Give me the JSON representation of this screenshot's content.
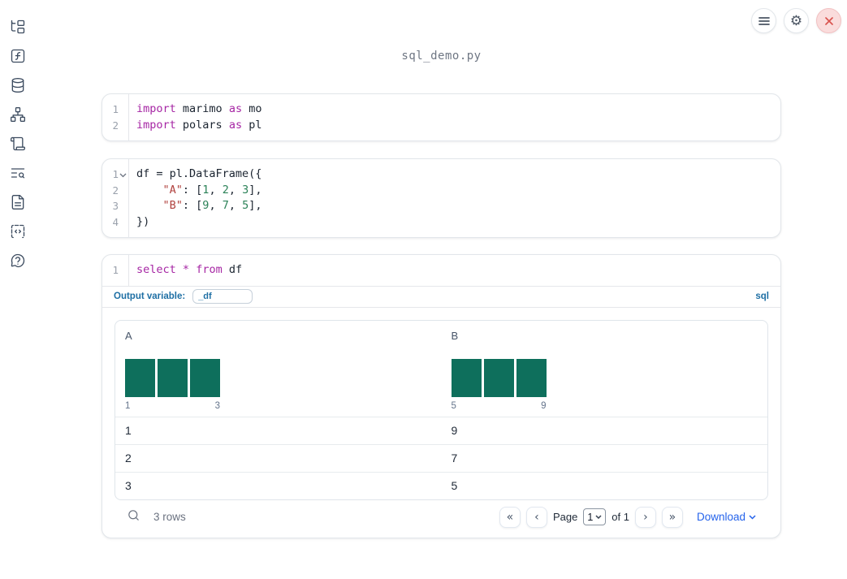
{
  "window": {
    "title": "sql_demo.py"
  },
  "header": {
    "buttons": [
      {
        "icon": "menu-icon"
      },
      {
        "icon": "gear-icon"
      },
      {
        "icon": "close-icon"
      }
    ]
  },
  "sidebar": {
    "items": [
      {
        "icon": "file-tree-icon"
      },
      {
        "icon": "function-square-icon"
      },
      {
        "icon": "database-icon"
      },
      {
        "icon": "dependency-graph-icon"
      },
      {
        "icon": "scroll-icon"
      },
      {
        "icon": "text-search-icon"
      },
      {
        "icon": "document-icon"
      },
      {
        "icon": "code-snippets-icon"
      },
      {
        "icon": "help-bubble-icon"
      }
    ]
  },
  "cells": [
    {
      "id": "imports-cell",
      "lines": [
        {
          "n": "1",
          "seg": [
            [
              "kw",
              "import"
            ],
            [
              "pl",
              " marimo "
            ],
            [
              "kw",
              "as"
            ],
            [
              "pl",
              " mo"
            ]
          ]
        },
        {
          "n": "2",
          "seg": [
            [
              "kw",
              "import"
            ],
            [
              "pl",
              " polars "
            ],
            [
              "kw",
              "as"
            ],
            [
              "pl",
              " pl"
            ]
          ]
        }
      ]
    },
    {
      "id": "dataframe-cell",
      "lines": [
        {
          "n": "1",
          "fold": true,
          "seg": [
            [
              "pl",
              "df = pl.DataFrame({"
            ]
          ]
        },
        {
          "n": "2",
          "seg": [
            [
              "pl",
              "    "
            ],
            [
              "str",
              "\"A\""
            ],
            [
              "pl",
              ": ["
            ],
            [
              "num",
              "1"
            ],
            [
              "pl",
              ", "
            ],
            [
              "num",
              "2"
            ],
            [
              "pl",
              ", "
            ],
            [
              "num",
              "3"
            ],
            [
              "pl",
              "],"
            ]
          ]
        },
        {
          "n": "3",
          "seg": [
            [
              "pl",
              "    "
            ],
            [
              "str",
              "\"B\""
            ],
            [
              "pl",
              ": ["
            ],
            [
              "num",
              "9"
            ],
            [
              "pl",
              ", "
            ],
            [
              "num",
              "7"
            ],
            [
              "pl",
              ", "
            ],
            [
              "num",
              "5"
            ],
            [
              "pl",
              "],"
            ]
          ]
        },
        {
          "n": "4",
          "seg": [
            [
              "pl",
              "})"
            ]
          ]
        }
      ]
    },
    {
      "id": "sql-cell",
      "lines": [
        {
          "n": "1",
          "seg": [
            [
              "kw",
              "select"
            ],
            [
              "pl",
              " "
            ],
            [
              "kw",
              "*"
            ],
            [
              "pl",
              " "
            ],
            [
              "kw",
              "from"
            ],
            [
              "pl",
              " df"
            ]
          ]
        }
      ]
    }
  ],
  "sql_cell": {
    "output_variable_label": "Output variable:",
    "output_variable_value": "_df",
    "language_badge": "sql"
  },
  "table": {
    "columns": [
      {
        "name": "A",
        "histogram": {
          "bins": [
            1,
            1,
            1
          ],
          "min_label": "1",
          "max_label": "3"
        }
      },
      {
        "name": "B",
        "histogram": {
          "bins": [
            1,
            1,
            1
          ],
          "min_label": "5",
          "max_label": "9"
        }
      }
    ],
    "rows": [
      [
        "1",
        "9"
      ],
      [
        "2",
        "7"
      ],
      [
        "3",
        "5"
      ]
    ],
    "footer": {
      "row_count": "3 rows",
      "page_label": "Page",
      "page_value": "1",
      "of_label": "of 1",
      "first_glyph": "«",
      "prev_glyph": "‹",
      "next_glyph": "›",
      "last_glyph": "»",
      "download_label": "Download"
    }
  },
  "colors": {
    "keyword": "#a626a4",
    "string": "#b0413e",
    "number": "#2b8258",
    "code_text": "#1b2430",
    "histogram_bar": "#0e6f5c",
    "sql_accent_blue": "#1e6fa4",
    "download_blue": "#2563eb",
    "close_red": "#d9534f"
  }
}
